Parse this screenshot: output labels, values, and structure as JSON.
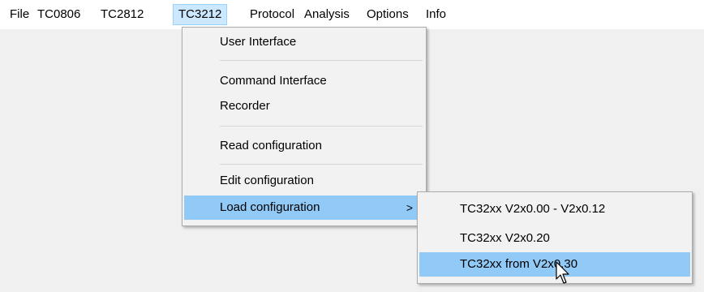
{
  "menubar": {
    "items": [
      "File",
      "TC0806",
      "TC2812",
      "TC3212",
      "Protocol",
      "Analysis",
      "Options",
      "Info"
    ]
  },
  "tc3212_menu": {
    "items": [
      {
        "label": "User Interface"
      },
      {
        "label": "Command Interface"
      },
      {
        "label": "Recorder"
      },
      {
        "label": "Read configuration"
      },
      {
        "label": "Edit configuration"
      },
      {
        "label": "Load configuration",
        "submenu_arrow": ">"
      }
    ]
  },
  "load_config_submenu": {
    "items": [
      {
        "label": "TC32xx V2x0.00 - V2x0.12"
      },
      {
        "label": "TC32xx V2x0.20"
      },
      {
        "label": "TC32xx from V2x0.30"
      }
    ]
  },
  "colors": {
    "menubar_active_bg": "#cce8ff",
    "menu_highlight_bg": "#91c9f7",
    "menu_bg": "#f2f2f2"
  },
  "icons": {
    "cursor": "mouse-pointer-icon"
  }
}
